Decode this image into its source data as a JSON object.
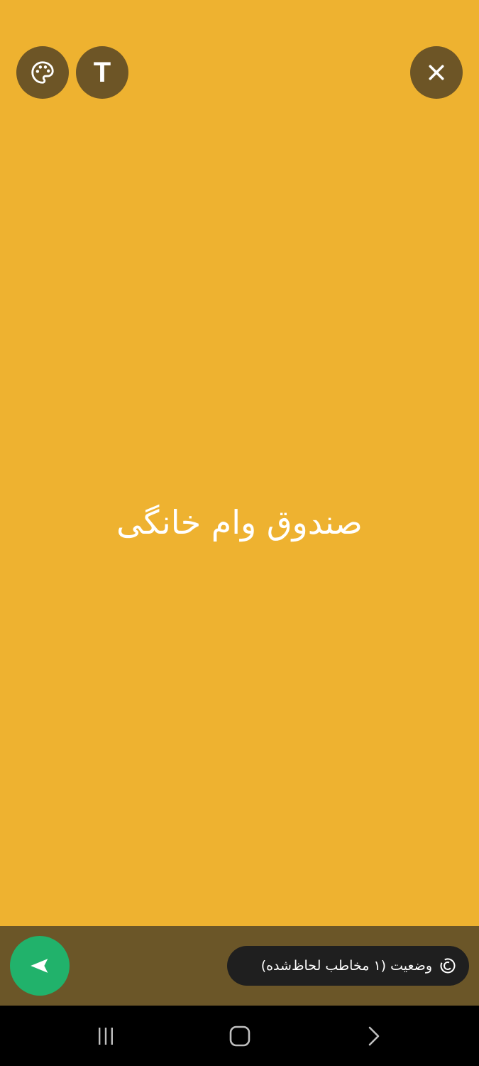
{
  "toolbar": {
    "text_button_label": "T",
    "icons": {
      "palette": "palette-icon",
      "close": "close-icon"
    }
  },
  "status_editor": {
    "text": "صندوق وام خانگی",
    "background_color": "#EEB230",
    "text_color": "#FFFFFF"
  },
  "bottom_bar": {
    "privacy_label": "وضعیت (۱ مخاطب لحاظ‌شده)",
    "privacy_icon": "status-ring-icon",
    "send_icon": "send-icon",
    "send_color": "#21B26B"
  },
  "nav_bar": {
    "recents_icon": "recents-icon",
    "home_icon": "home-icon",
    "back_icon": "back-icon"
  }
}
